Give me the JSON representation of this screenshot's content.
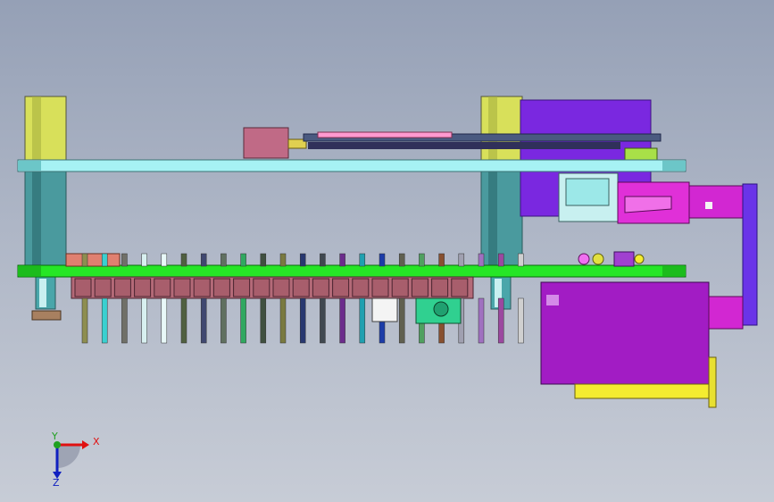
{
  "viewport": {
    "background_top": "#95a0b6",
    "background_bottom": "#c7ccd6"
  },
  "triad": {
    "x_label": "X",
    "y_label": "Y",
    "z_label": "Z",
    "x_color": "#e01010",
    "y_color": "#20a020",
    "z_color": "#1020c0"
  },
  "model": {
    "top_board_color": "#a6f2f4",
    "bottom_board_color": "#26e626",
    "header_body_color": "#b46a78",
    "standoff_color": "#d8e05a",
    "connector_color": "#a21cc4",
    "usb_color": "#d227d2",
    "pin_colors": [
      "#8e8e50",
      "#3ad0d0",
      "#707068",
      "#d8f0f0",
      "#e8f8f8",
      "#506040",
      "#404870",
      "#607060",
      "#30a860",
      "#405040",
      "#7a7a40",
      "#283870",
      "#404850",
      "#6c2c8c",
      "#20a0b0",
      "#1c3ca8",
      "#606050",
      "#50a060",
      "#885030",
      "#a0a0b0",
      "#a070c0",
      "#9c48a0",
      "#d0d0d0"
    ]
  }
}
